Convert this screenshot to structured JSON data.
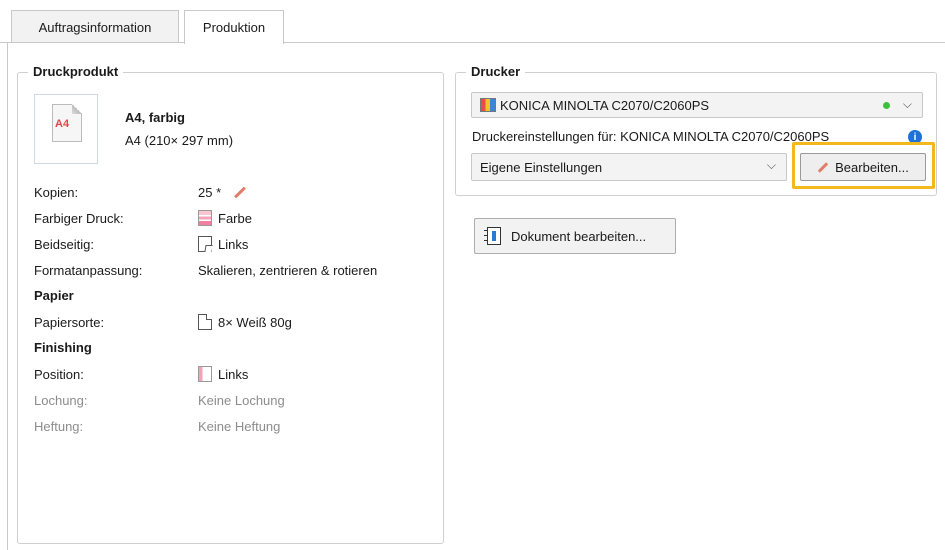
{
  "tabs": [
    {
      "label": "Auftragsinformation",
      "active": false
    },
    {
      "label": "Produktion",
      "active": true
    }
  ],
  "druckprodukt": {
    "title": "Druckprodukt",
    "thumb_label": "A4",
    "product_name": "A4, farbig",
    "product_size": "A4 (210× 297 mm)",
    "rows": [
      {
        "label": "Kopien:",
        "value": "25 *",
        "icon": "pencil-icon"
      },
      {
        "label": "Farbiger Druck:",
        "value": "Farbe",
        "icon": "color-print-icon"
      },
      {
        "label": "Beidseitig:",
        "value": "Links",
        "icon": "duplex-icon"
      },
      {
        "label": "Formatanpassung:",
        "value": "Skalieren, zentrieren & rotieren"
      }
    ],
    "papier_title": "Papier",
    "papier_rows": [
      {
        "label": "Papiersorte:",
        "value": "8× Weiß 80g",
        "icon": "paper-icon"
      }
    ],
    "finishing_title": "Finishing",
    "finishing_rows": [
      {
        "label": "Position:",
        "value": "Links",
        "icon": "position-icon"
      },
      {
        "label": "Lochung:",
        "value": "Keine Lochung"
      },
      {
        "label": "Heftung:",
        "value": "Keine Heftung"
      }
    ]
  },
  "drucker": {
    "title": "Drucker",
    "printer": "KONICA MINOLTA C2070/C2060PS",
    "settings_label": "Druckereinstellungen für: KONICA MINOLTA C2070/C2060PS",
    "settings_value": "Eigene Einstellungen",
    "edit_button": "Bearbeiten...",
    "status_color": "#3fbf3f"
  },
  "document_button": "Dokument bearbeiten...",
  "colors": {
    "highlight": "#f2b81c",
    "info": "#1b73d9"
  }
}
